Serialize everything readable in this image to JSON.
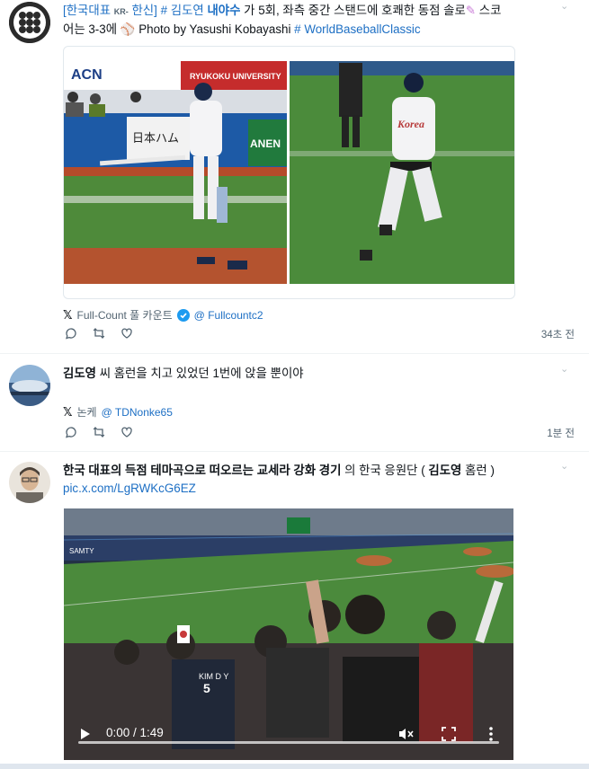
{
  "post1": {
    "text_line1": {
      "bracket_open": "[",
      "tag_team": "한국대표",
      "tag_kr": "KR-",
      "tag_team2": "한신",
      "bracket_close": "]",
      "hashtag1": "# 김도연",
      "name": "내야수",
      "rest": "가 5회, 좌측 중간 스탠드에 호쾌한 동점 솔로",
      "score_word": "스코"
    },
    "text_line2": {
      "start": "어는 3-3에",
      "credit": "Photo by Yasushi Kobayashi",
      "hashtag2": "# WorldBaseballClassic"
    },
    "via_prefix": "Full-Count 풀 카운트",
    "via_handle": "@ Fullcountc2",
    "time": "34초 전",
    "ad_banner": "ACN",
    "university_banner": "RYUKOKU UNIVERSITY",
    "banner_jp": "日本ハム",
    "banner_green": "ANEN"
  },
  "post2": {
    "name": "김도영",
    "text": "씨 홈런을 치고 있었던 1번에 앉을 뿐이야",
    "via_prefix": "논케",
    "via_handle": "@ TDNonke65",
    "time": "1분 전"
  },
  "post3": {
    "text_bold": "한국 대표의 득점 테마곡으로 떠오르는 교세라 강화 경기",
    "text_mid": "의 한국 응원단 (",
    "name": "김도영",
    "text_end": "홈런 )",
    "link": "pic.x.com/LgRWKcG6EZ",
    "video_time": "0:00 / 1:49",
    "jersey_num": "5",
    "jersey_name": "KIM D Y"
  },
  "colors": {
    "link": "#1d6fc4",
    "verified": "#1d9bf0",
    "field_green": "#4e8a3a"
  },
  "icons": [
    "reply-icon",
    "retweet-icon",
    "like-icon",
    "x-logo-icon",
    "verified-icon",
    "play-icon",
    "mute-icon",
    "fullscreen-icon",
    "more-icon",
    "chevron-down-icon"
  ]
}
